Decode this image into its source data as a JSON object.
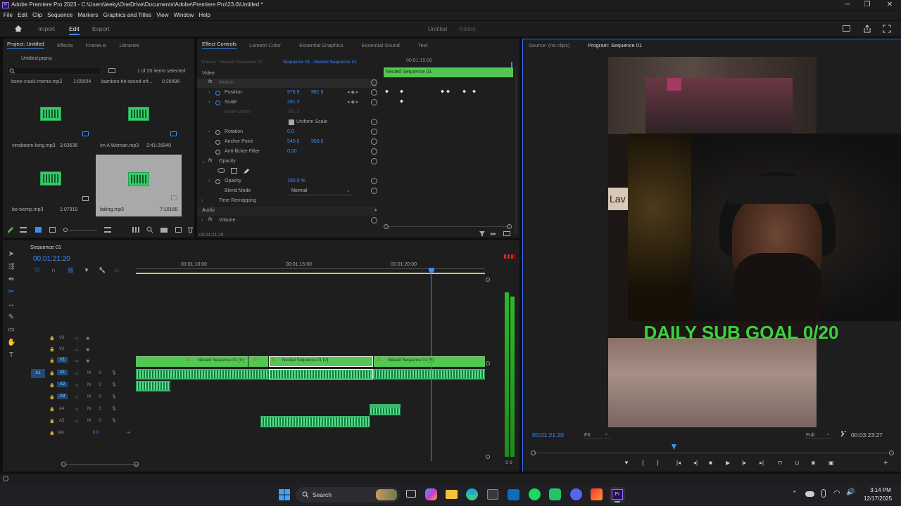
{
  "window": {
    "title": "Adobe Premiere Pro 2023 - C:\\Users\\leeky\\OneDrive\\Documents\\Adobe\\Premiere Pro\\23.0\\Untitled *",
    "min": "─",
    "max": "❐",
    "close": "✕"
  },
  "menu": [
    "File",
    "Edit",
    "Clip",
    "Sequence",
    "Markers",
    "Graphics and Titles",
    "View",
    "Window",
    "Help"
  ],
  "workspace": {
    "home_icon": "home-icon",
    "tabs": [
      "Import",
      "Edit",
      "Export"
    ],
    "active": "Edit",
    "project_title": "Untitled",
    "status": "- Edited"
  },
  "project": {
    "tabs": [
      "Project: Untitled",
      "Effects",
      "Frame.io",
      "Libraries"
    ],
    "file": "Untitled.prproj",
    "count": "1 of 20 items selected",
    "items": [
      {
        "name": "bone-crack-meme.mp3",
        "dur": "1:05004"
      },
      {
        "name": "bamboo-hit-sound-eff...",
        "dur": "0:26496"
      },
      {
        "name": "vineboom-long.mp3",
        "dur": "3:03636"
      },
      {
        "name": "Im A Woman.mp3",
        "dur": "2:41:26940"
      },
      {
        "name": "bo-womp.mp3",
        "dur": "1:07919"
      },
      {
        "name": "failing.mp3",
        "dur": "7:10166"
      }
    ]
  },
  "effects": {
    "tabs": [
      "Effect Controls",
      "Lumetri Color",
      "Essential Graphics",
      "Essential Sound",
      "Text"
    ],
    "source": "Source - Nested Sequence 01",
    "seq": "Sequence 01 - Nested Sequence 01",
    "timecode": "00:01:15:00",
    "clip_label": "Nested Sequence 01",
    "video": "Video",
    "motion": "Motion",
    "position": "Position",
    "pos_x": "976.9",
    "pos_y": "981.8",
    "scale": "Scale",
    "scale_v": "261.3",
    "scale_w": "Scale Width",
    "scale_w_v": "261.3",
    "uniform": "Uniform Scale",
    "rotation": "Rotation",
    "rot_v": "0.0",
    "anchor": "Anchor Point",
    "anc_x": "540.0",
    "anc_y": "960.0",
    "flicker": "Anti-flicker Filter",
    "flick_v": "0.00",
    "opacity_sec": "Opacity",
    "opacity": "Opacity",
    "opacity_v": "100.0 %",
    "blend": "Blend Mode",
    "blend_v": "Normal",
    "remap": "Time Remapping",
    "audio": "Audio",
    "volume": "Volume",
    "current": "00:01:21:19"
  },
  "source_mon": {
    "tabs": [
      "Source: (no clips)",
      "Program: Sequence 01"
    ]
  },
  "program": {
    "timecode": "00:01:21:20",
    "fit": "Fit",
    "full": "Full",
    "duration": "00:03:23:27",
    "overlay_text": "DAILY SUB GOAL 0/20",
    "lav": "Lav"
  },
  "timeline": {
    "tab": "Sequence 01",
    "timecode": "00:01:21:20",
    "ruler": [
      "00:01:10:00",
      "00:01:15:00",
      "00:01:20:00"
    ],
    "vtracks": [
      "V3",
      "V2",
      "V1"
    ],
    "atracks": [
      "A1",
      "A2",
      "A3",
      "A4",
      "A5"
    ],
    "mix": "Mix",
    "mix_v": "0.0",
    "clips": [
      "Nested Sequence 01 [V]",
      "Nested Sequence 01 [V]",
      "Nested Sequence 01 [V]"
    ],
    "meter": "S S"
  },
  "taskbar": {
    "search": "Search",
    "time": "3:14 PM",
    "date": "12/17/2025"
  }
}
